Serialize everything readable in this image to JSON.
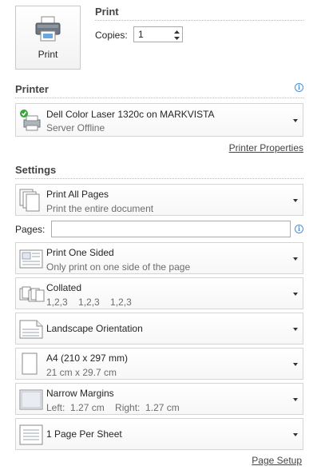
{
  "print_button": {
    "label": "Print",
    "icon": "printer-icon"
  },
  "print_section": {
    "title": "Print",
    "copies_label": "Copies:",
    "copies_value": "1"
  },
  "printer_section": {
    "title": "Printer",
    "info_icon": "info-icon",
    "selected_printer": {
      "name": "Dell Color Laser 1320c on MARKVISTA",
      "status": "Server Offline",
      "icon": "printer-ready-icon"
    },
    "properties_link": "Printer Properties"
  },
  "settings_section": {
    "title": "Settings",
    "pages_label": "Pages:",
    "pages_value": "",
    "options": [
      {
        "title": "Print All Pages",
        "subtitle": "Print the entire document",
        "icon": "pages-icon"
      },
      {
        "title": "Print One Sided",
        "subtitle": "Only print on one side of the page",
        "icon": "one-sided-icon"
      },
      {
        "title": "Collated",
        "subtitle": "1,2,3    1,2,3    1,2,3",
        "icon": "collated-icon"
      },
      {
        "title": "Landscape Orientation",
        "subtitle": "",
        "icon": "landscape-icon"
      },
      {
        "title": "A4 (210 x 297 mm)",
        "subtitle": "21 cm x 29.7 cm",
        "icon": "paper-size-icon"
      },
      {
        "title": "Narrow Margins",
        "subtitle": "Left:  1.27 cm    Right:  1.27 cm",
        "icon": "margins-icon"
      },
      {
        "title": "1 Page Per Sheet",
        "subtitle": "",
        "icon": "pages-per-sheet-icon"
      }
    ],
    "page_setup_link": "Page Setup"
  },
  "colors": {
    "accent_info": "#4a90d9",
    "border": "#d4d4d4",
    "secondary_text": "#6d6d6d"
  }
}
